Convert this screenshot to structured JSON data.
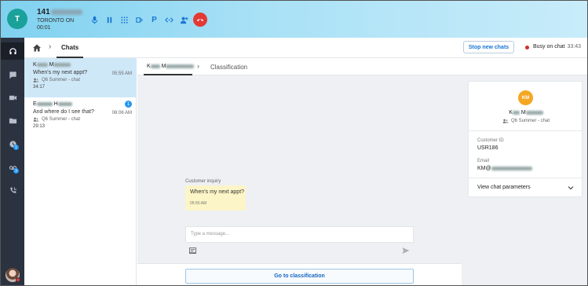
{
  "call": {
    "avatar_letter": "T",
    "number_prefix": "141",
    "location": "TORONTO ON",
    "duration": "00:01",
    "controls": [
      "microphone-icon",
      "pause-icon",
      "dialpad-icon",
      "transfer-icon",
      "park-icon",
      "conference-icon",
      "add-participant-icon",
      "hangup-icon"
    ],
    "park_label": "P"
  },
  "colors": {
    "accent": "#1976d2",
    "hangup": "#e53935",
    "selected_row": "#cfe8f8",
    "bubble": "#fcf5c7",
    "customer_avatar": "#f5a623",
    "call_avatar": "#1aa19a"
  },
  "nav": {
    "items": [
      "headset-icon",
      "chat-icon",
      "video-icon",
      "folder-icon",
      "history-icon",
      "voicemail-icon",
      "callback-icon"
    ],
    "badges": {
      "history": "1",
      "voicemail": "3"
    }
  },
  "header": {
    "breadcrumb_current": "Chats",
    "stop_button": "Stop new chats",
    "status_label": "Busy on chat",
    "status_time": "33:43"
  },
  "chats": [
    {
      "initial_first": "K",
      "initial_last": "M",
      "message": "When's my next appt?",
      "time": "05:55 AM",
      "channel": "Q6 Summer - chat",
      "duration": "34:17",
      "badge": ""
    },
    {
      "initial_first": "E",
      "initial_last": "H",
      "message": "And where do I see that?",
      "time": "06:06 AM",
      "channel": "Q6 Summer - chat",
      "duration": "29:13",
      "badge": "1"
    }
  ],
  "conversation": {
    "tab_initial_first": "K",
    "tab_initial_last": "M",
    "classification_tab": "Classification",
    "customer_label": "Customer inquiry",
    "message": "When's my next appt?",
    "message_time": "05:55 AM",
    "input_placeholder": "Type a message...",
    "go_button": "Go to classification"
  },
  "customer": {
    "avatar_initials": "KM",
    "initial_first": "K",
    "initial_last": "M",
    "channel": "Q6 Summer - chat",
    "id_label": "Customer ID",
    "id_value": "USR186",
    "email_label": "Email",
    "email_prefix": "KM@",
    "params_label": "View chat parameters"
  }
}
